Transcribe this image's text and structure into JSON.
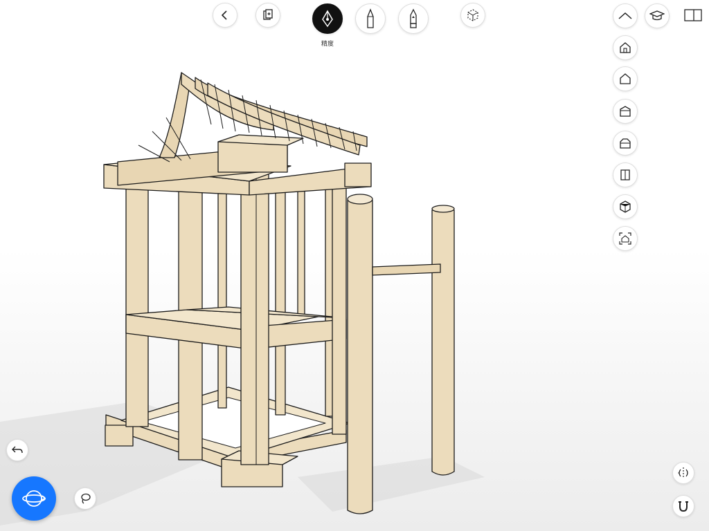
{
  "toolbar": {
    "active_tool_label": "精度"
  },
  "icons": {
    "back": "chevron-left-icon",
    "pages": "pages-icon",
    "pen": "fountain-pen-icon",
    "pencil": "pencil-icon",
    "marker": "marker-icon",
    "fit_view": "fit-view-icon",
    "collapse": "chevron-up-icon",
    "learn": "graduation-cap-icon",
    "panel": "panel-toggle-icon",
    "undo": "undo-icon",
    "orbit": "orbit-icon",
    "lasso": "lasso-icon",
    "section_plane": "section-plane-icon",
    "snap_magnet": "magnet-icon"
  },
  "views": [
    "home",
    "top",
    "front",
    "back",
    "side",
    "iso",
    "zoom-extents"
  ],
  "colors": {
    "accent": "#1677ff",
    "model_wood": "#ecdcbc",
    "active_tool_bg": "#111111"
  }
}
